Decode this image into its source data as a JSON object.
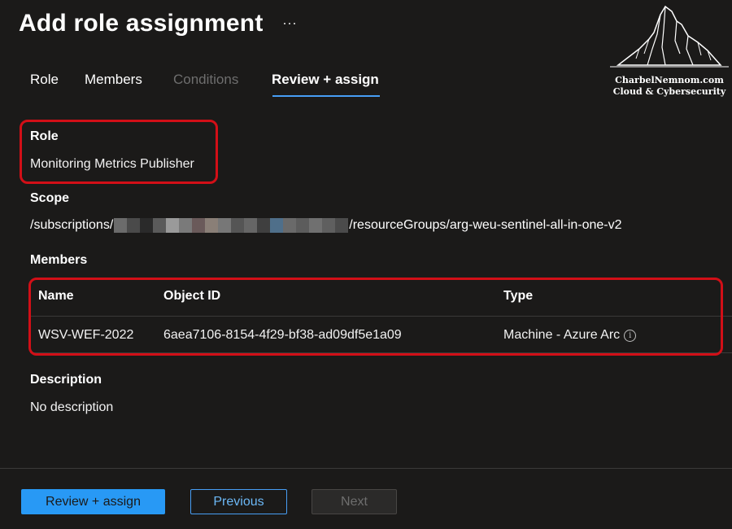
{
  "header": {
    "title": "Add role assignment",
    "more": "···"
  },
  "tabs": [
    {
      "label": "Role",
      "state": "normal"
    },
    {
      "label": "Members",
      "state": "normal"
    },
    {
      "label": "Conditions",
      "state": "disabled"
    },
    {
      "label": "Review + assign",
      "state": "active"
    }
  ],
  "role": {
    "label": "Role",
    "value": "Monitoring Metrics Publisher"
  },
  "scope": {
    "label": "Scope",
    "prefix": "/subscriptions/",
    "suffix": "/resourceGroups/arg-weu-sentinel-all-in-one-v2"
  },
  "members": {
    "label": "Members",
    "columns": [
      "Name",
      "Object ID",
      "Type"
    ],
    "rows": [
      {
        "name": "WSV-WEF-2022",
        "object_id": "6aea7106-8154-4f29-bf38-ad09df5e1a09",
        "type": "Machine - Azure Arc"
      }
    ]
  },
  "description": {
    "label": "Description",
    "value": "No description"
  },
  "footer": {
    "review_assign": "Review + assign",
    "previous": "Previous",
    "next": "Next"
  },
  "watermark": {
    "line1": "CharbelNemnom.com",
    "line2": "Cloud & Cybersecurity"
  },
  "colors": {
    "accent": "#2899f5",
    "highlight": "#d20f17",
    "background": "#1b1a19"
  }
}
